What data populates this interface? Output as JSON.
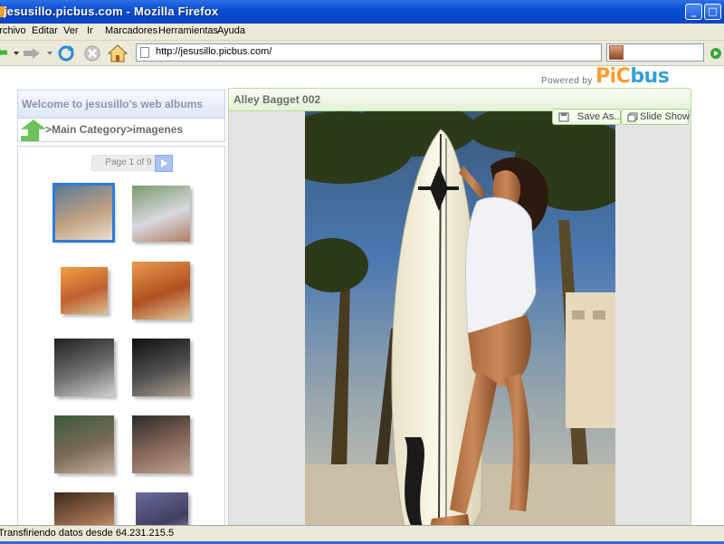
{
  "window": {
    "title": "jesusillo.picbus.com - Mozilla Firefox"
  },
  "menu": {
    "items": [
      "Archivo",
      "Editar",
      "Ver",
      "Ir",
      "Marcadores",
      "Herramientas",
      "Ayuda"
    ]
  },
  "toolbar": {
    "url": "http://jesusillo.picbus.com/",
    "icons": [
      "back-icon",
      "forward-icon",
      "reload-icon",
      "stop-icon",
      "home-icon",
      "go-icon"
    ]
  },
  "header": {
    "powered_by": "Powered by",
    "logo_pic": "PiC",
    "logo_bus": "bus"
  },
  "sidebar": {
    "welcome": "Welcome to jesusillo's web albums",
    "breadcrumb": ">Main Category>imagenes",
    "pager": "Page 1 of 9",
    "thumbnails": [
      {
        "selected": true,
        "colors": [
          "#5a7a9a",
          "#c0a080",
          "#e8e0d0"
        ]
      },
      {
        "selected": false,
        "colors": [
          "#7a9a6a",
          "#d8d8e0",
          "#b08060"
        ]
      },
      {
        "selected": false,
        "colors": [
          "#f0a040",
          "#c06030",
          "#d8c090"
        ]
      },
      {
        "selected": false,
        "colors": [
          "#e89a50",
          "#b05020",
          "#e0c8a0"
        ]
      },
      {
        "selected": false,
        "colors": [
          "#202020",
          "#707070",
          "#d0d0d0"
        ]
      },
      {
        "selected": false,
        "colors": [
          "#101010",
          "#505050",
          "#b0a090"
        ]
      },
      {
        "selected": false,
        "colors": [
          "#3a5a3a",
          "#7a6a5a",
          "#c8b0a0"
        ]
      },
      {
        "selected": false,
        "colors": [
          "#2a2a2a",
          "#8a6a5a",
          "#c0a090"
        ]
      },
      {
        "selected": false,
        "colors": [
          "#3a2a1a",
          "#a07050",
          "#e0c0a0"
        ]
      },
      {
        "selected": false,
        "colors": [
          "#6a6aa0",
          "#404060",
          "#c0a0c0"
        ]
      }
    ]
  },
  "viewer": {
    "title": "Alley Bagget 002",
    "save_as": "Save As...",
    "slide_show": "Slide Show"
  },
  "status": {
    "text": "Transfiriendo datos desde 64.231.215.5"
  },
  "colors": {
    "titlebar": "#0a4fd3",
    "chrome": "#ece9d8",
    "accent_green": "#a6d28a",
    "accent_blue": "#2f7bd8"
  }
}
